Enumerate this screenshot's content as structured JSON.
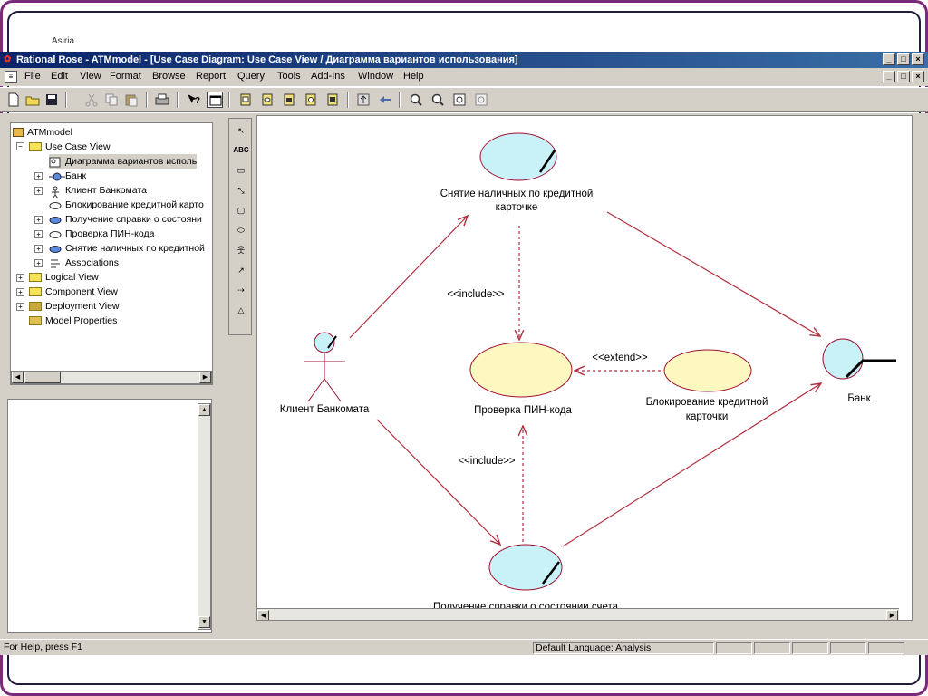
{
  "slide": {
    "label": "Asiria"
  },
  "window": {
    "title": "Rational Rose - ATMmodel - [Use Case Diagram: Use Case View / Диаграмма вариантов использования]"
  },
  "menu": {
    "items": [
      "File",
      "Edit",
      "View",
      "Format",
      "Browse",
      "Report",
      "Query",
      "Tools",
      "Add-Ins",
      "Window",
      "Help"
    ]
  },
  "toolbar": {
    "buttons": [
      "new-file-icon",
      "open-folder-icon",
      "save-icon",
      "cut-icon",
      "copy-icon",
      "paste-icon",
      "print-icon",
      "context-help-icon",
      "view-doc-icon",
      "browse-class-icon",
      "browse-usecase-icon",
      "browse-component-icon",
      "browse-deployment-icon",
      "browse-parent-icon",
      "browse-previous-icon",
      "zoom-in-icon",
      "zoom-out-icon",
      "fit-window-icon",
      "undo-fit-icon"
    ]
  },
  "tree": {
    "root": "ATMmodel",
    "use_case_view": "Use Case View",
    "diagram_item": "Диаграмма вариантов исполь",
    "bank": "Банк",
    "client": "Клиент Банкомата",
    "block": "Блокирование кредитной карто",
    "balance": "Получение справки о состояни",
    "pin": "Проверка ПИН-кода",
    "withdraw": "Снятие наличных по кредитной",
    "associations": "Associations",
    "logical_view": "Logical View",
    "component_view": "Component View",
    "deployment_view": "Deployment View",
    "model_properties": "Model Properties"
  },
  "palette": {
    "tools": [
      "selection-arrow-icon",
      "text-box-icon",
      "note-icon",
      "anchor-note-icon",
      "package-icon",
      "use-case-icon",
      "actor-icon",
      "unidirectional-association-icon",
      "dependency-icon",
      "generalization-icon"
    ],
    "abc_label": "ABC"
  },
  "diagram": {
    "withdraw_l1": "Снятие наличных по кредитной",
    "withdraw_l2": "карточке",
    "pin": "Проверка ПИН-кода",
    "block_l1": "Блокирование кредитной",
    "block_l2": "карточки",
    "balance": "Получение справки о состоянии счета",
    "client": "Клиент Банкомата",
    "bank": "Банк",
    "include_top": "<<include>>",
    "include_bottom": "<<include>>",
    "extend": "<<extend>>"
  },
  "status": {
    "help": "For Help, press F1",
    "language": "Default Language: Analysis"
  },
  "colors": {
    "title_gradient_start": "#0a246a",
    "title_gradient_end": "#3a6ea5",
    "usecase_fill_cyan": "#c8f2f8",
    "usecase_fill_yellow": "#fdf8c0",
    "outline": "#a01030",
    "arrow": "#b03040"
  }
}
